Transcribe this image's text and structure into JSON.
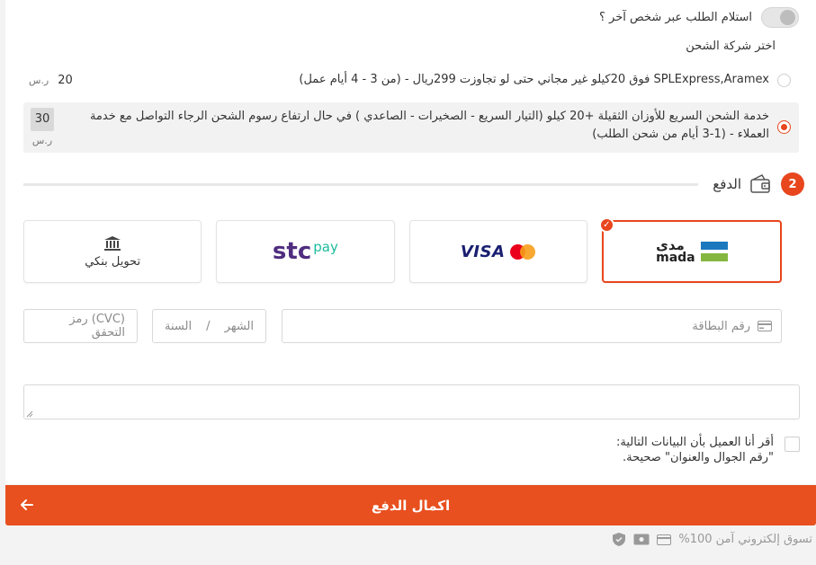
{
  "receive_other": {
    "label": "استلام الطلب عبر شخص آخر ؟"
  },
  "shipping": {
    "title": "اختر شركة الشحن",
    "options": [
      {
        "text": "SPLExpress,Aramex فوق 20كيلو غير مجاني حتى لو تجاوزت 299ريال - (من 3 - 4 أيام عمل)",
        "price": "20",
        "currency": "ر.س"
      },
      {
        "text": "خدمة الشحن السريع للأوزان الثقيلة +20 كيلو (التيار السريع - الصخيرات - الصاعدي ) في حال ارتفاع رسوم الشحن الرجاء التواصل مع خدمة العملاء - (1-3 أيام من شحن الطلب)",
        "price": "30",
        "currency": "ر.س"
      }
    ]
  },
  "payment": {
    "step": "2",
    "title": "الدفع",
    "methods": {
      "mada_ar": "مدى",
      "mada_en": "mada",
      "visa": "VISA",
      "stc_main": "stc",
      "stc_pay": "pay",
      "bank": "تحويل بنكي"
    },
    "card_number_placeholder": "رقم البطاقة",
    "month_placeholder": "الشهر",
    "date_separator": "/",
    "year_placeholder": "السنة",
    "cvc_placeholder": "(CVC) رمز التحقق"
  },
  "agreement": {
    "line1": "أقر أنا العميل بأن البيانات التالية:",
    "line2": "\"رقم الجوال والعنوان\" صحيحة."
  },
  "submit": {
    "label": "اكمال الدفع"
  },
  "footer": {
    "secure_text": "تسوق إلكتروني آمن 100%"
  },
  "colors": {
    "accent": "#e8501f",
    "mada_blue": "#1b78bd",
    "mada_green": "#84b740"
  }
}
